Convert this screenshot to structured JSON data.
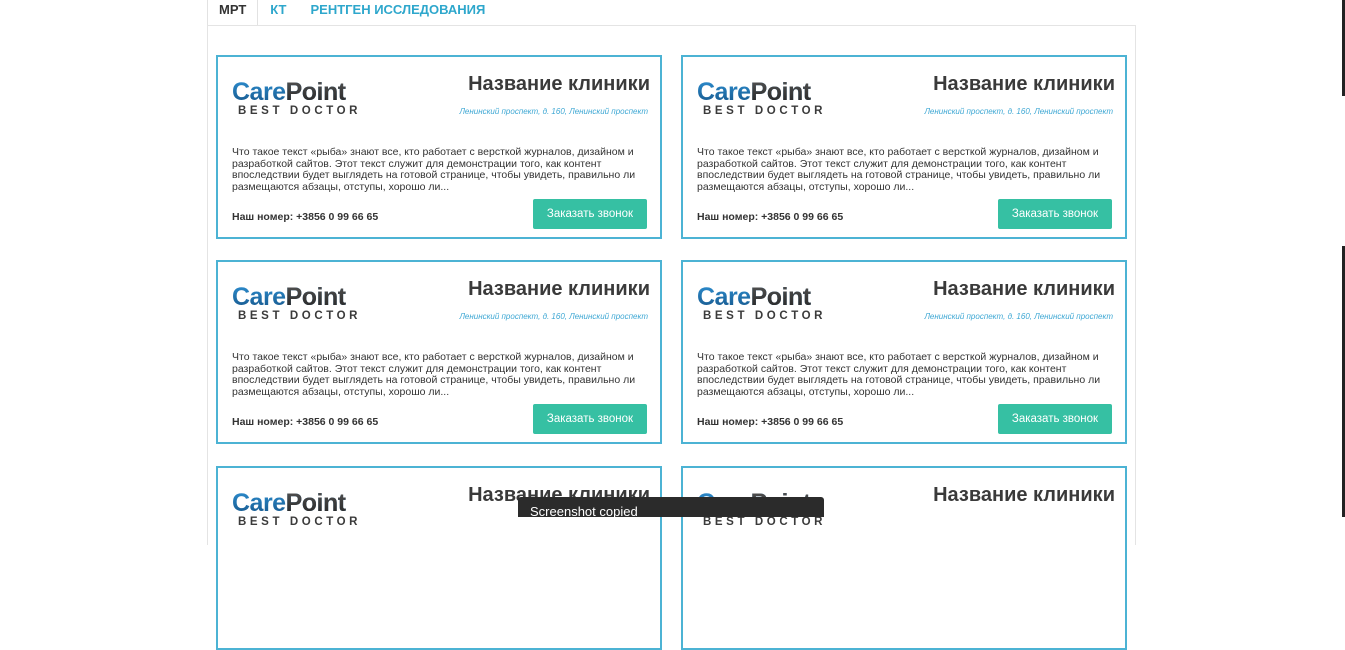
{
  "tabs": [
    {
      "label": "МРТ",
      "active": true
    },
    {
      "label": "КТ",
      "active": false
    },
    {
      "label": "РЕНТГЕН ИССЛЕДОВАНИЯ",
      "active": false
    }
  ],
  "colors": {
    "accent": "#2ea7cc",
    "card_border": "#4cb3d4",
    "button": "#36c0a3",
    "text": "#333333"
  },
  "cards": [
    {
      "logo_main": "Care",
      "logo_accent": "Point",
      "logo_tag": "BEST DOCTOR",
      "clinic": "Название клиники",
      "address": "Ленинский проспект, д. 160, Ленинский проспект",
      "desc": "Что такое текст «рыба» знают все, кто работает с версткой журналов, дизайном и разработкой сайтов. Этот текст служит для демонстрации того, как контент впоследствии будет выглядеть на готовой странице, чтобы увидеть, правильно ли размещаются абзацы, отступы, хорошо ли...",
      "phone": "Наш номер: +3856 0 99 66 65",
      "button": "Заказать звонок"
    },
    {
      "logo_main": "Care",
      "logo_accent": "Point",
      "logo_tag": "BEST DOCTOR",
      "clinic": "Название клиники",
      "address": "Ленинский проспект, д. 160, Ленинский проспект",
      "desc": "Что такое текст «рыба» знают все, кто работает с версткой журналов, дизайном и разработкой сайтов. Этот текст служит для демонстрации того, как контент впоследствии будет выглядеть на готовой странице, чтобы увидеть, правильно ли размещаются абзацы, отступы, хорошо ли...",
      "phone": "Наш номер: +3856 0 99 66 65",
      "button": "Заказать звонок"
    },
    {
      "logo_main": "Care",
      "logo_accent": "Point",
      "logo_tag": "BEST DOCTOR",
      "clinic": "Название клиники",
      "address": "Ленинский проспект, д. 160, Ленинский проспект",
      "desc": "Что такое текст «рыба» знают все, кто работает с версткой журналов, дизайном и разработкой сайтов. Этот текст служит для демонстрации того, как контент впоследствии будет выглядеть на готовой странице, чтобы увидеть, правильно ли размещаются абзацы, отступы, хорошо ли...",
      "phone": "Наш номер: +3856 0 99 66 65",
      "button": "Заказать звонок"
    },
    {
      "logo_main": "Care",
      "logo_accent": "Point",
      "logo_tag": "BEST DOCTOR",
      "clinic": "Название клиники",
      "address": "Ленинский проспект, д. 160, Ленинский проспект",
      "desc": "Что такое текст «рыба» знают все, кто работает с версткой журналов, дизайном и разработкой сайтов. Этот текст служит для демонстрации того, как контент впоследствии будет выглядеть на готовой странице, чтобы увидеть, правильно ли размещаются абзацы, отступы, хорошо ли...",
      "phone": "Наш номер: +3856 0 99 66 65",
      "button": "Заказать звонок"
    },
    {
      "logo_main": "Care",
      "logo_accent": "Point",
      "logo_tag": "BEST DOCTOR",
      "clinic": "Название клиники",
      "address": "",
      "desc": "",
      "phone": "",
      "button": ""
    },
    {
      "logo_main": "Care",
      "logo_accent": "Point",
      "logo_tag": "BEST DOCTOR",
      "clinic": "Название клиники",
      "address": "",
      "desc": "",
      "phone": "",
      "button": ""
    }
  ],
  "toast": {
    "text": "Screenshot copied"
  }
}
